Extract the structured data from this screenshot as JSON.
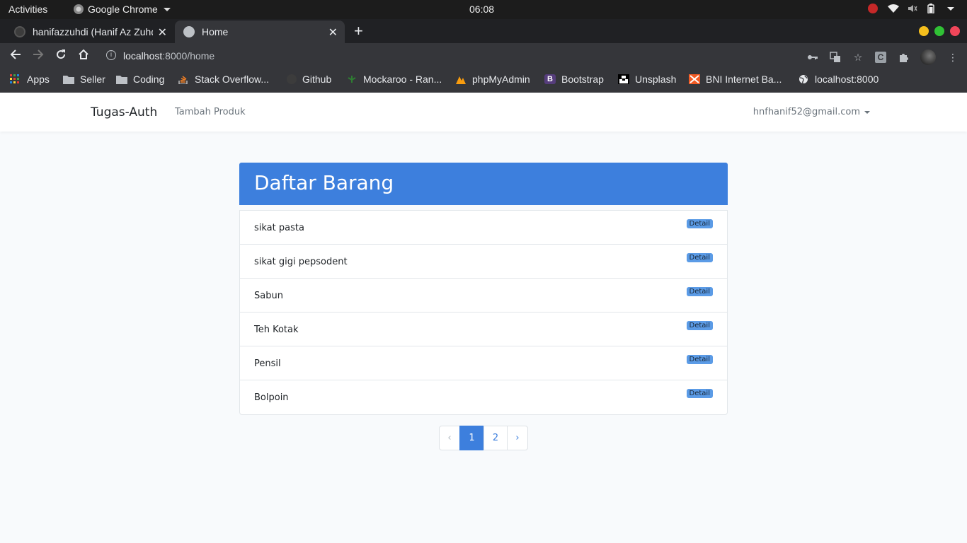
{
  "system": {
    "activities": "Activities",
    "app_name": "Google Chrome",
    "clock": "06:08"
  },
  "browser": {
    "tabs": [
      {
        "title": "hanifazzuhdi (Hanif Az Zuhdi)"
      },
      {
        "title": "Home"
      }
    ],
    "url_host": "localhost",
    "url_path": ":8000/home",
    "profile_letter": "C",
    "bookmarks": [
      {
        "label": "Apps"
      },
      {
        "label": "Seller"
      },
      {
        "label": "Coding"
      },
      {
        "label": "Stack Overflow..."
      },
      {
        "label": "Github"
      },
      {
        "label": "Mockaroo - Ran..."
      },
      {
        "label": "phpMyAdmin"
      },
      {
        "label": "Bootstrap"
      },
      {
        "label": "Unsplash"
      },
      {
        "label": "BNI Internet Ba..."
      },
      {
        "label": "localhost:8000"
      }
    ]
  },
  "navbar": {
    "brand": "Tugas-Auth",
    "link": "Tambah Produk",
    "user": "hnfhanif52@gmail.com"
  },
  "card": {
    "title": "Daftar Barang"
  },
  "items": [
    {
      "name": "sikat pasta",
      "badge": "Detail"
    },
    {
      "name": "sikat gigi pepsodent",
      "badge": "Detail"
    },
    {
      "name": "Sabun",
      "badge": "Detail"
    },
    {
      "name": "Teh Kotak",
      "badge": "Detail"
    },
    {
      "name": "Pensil",
      "badge": "Detail"
    },
    {
      "name": "Bolpoin",
      "badge": "Detail"
    }
  ],
  "pagination": {
    "prev": "‹",
    "pages": [
      "1",
      "2"
    ],
    "current": "1",
    "next": "›"
  },
  "colors": {
    "primary": "#3d7fdd",
    "badge": "#5b9be6",
    "background": "#f8fafc"
  }
}
